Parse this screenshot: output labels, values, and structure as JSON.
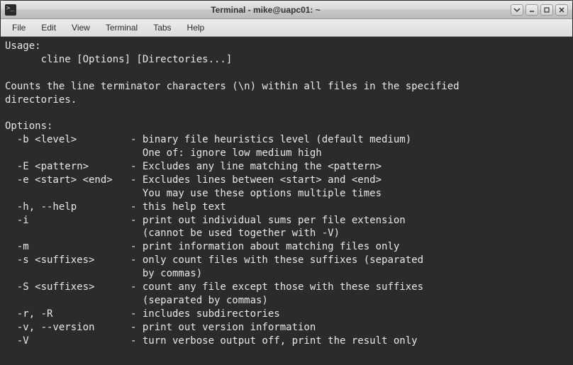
{
  "window": {
    "title": "Terminal - mike@uapc01: ~"
  },
  "menu": {
    "file": "File",
    "edit": "Edit",
    "view": "View",
    "terminal": "Terminal",
    "tabs": "Tabs",
    "help": "Help"
  },
  "terminal": {
    "lines": [
      "Usage:",
      "      cline [Options] [Directories...]",
      "",
      "Counts the line terminator characters (\\n) within all files in the specified",
      "directories.",
      "",
      "Options:",
      "  -b <level>         - binary file heuristics level (default medium)",
      "                       One of: ignore low medium high",
      "  -E <pattern>       - Excludes any line matching the <pattern>",
      "  -e <start> <end>   - Excludes lines between <start> and <end>",
      "                       You may use these options multiple times",
      "  -h, --help         - this help text",
      "  -i                 - print out individual sums per file extension",
      "                       (cannot be used together with -V)",
      "  -m                 - print information about matching files only",
      "  -s <suffixes>      - only count files with these suffixes (separated",
      "                       by commas)",
      "  -S <suffixes>      - count any file except those with these suffixes",
      "                       (separated by commas)",
      "  -r, -R             - includes subdirectories",
      "  -v, --version      - print out version information",
      "  -V                 - turn verbose output off, print the result only"
    ]
  }
}
